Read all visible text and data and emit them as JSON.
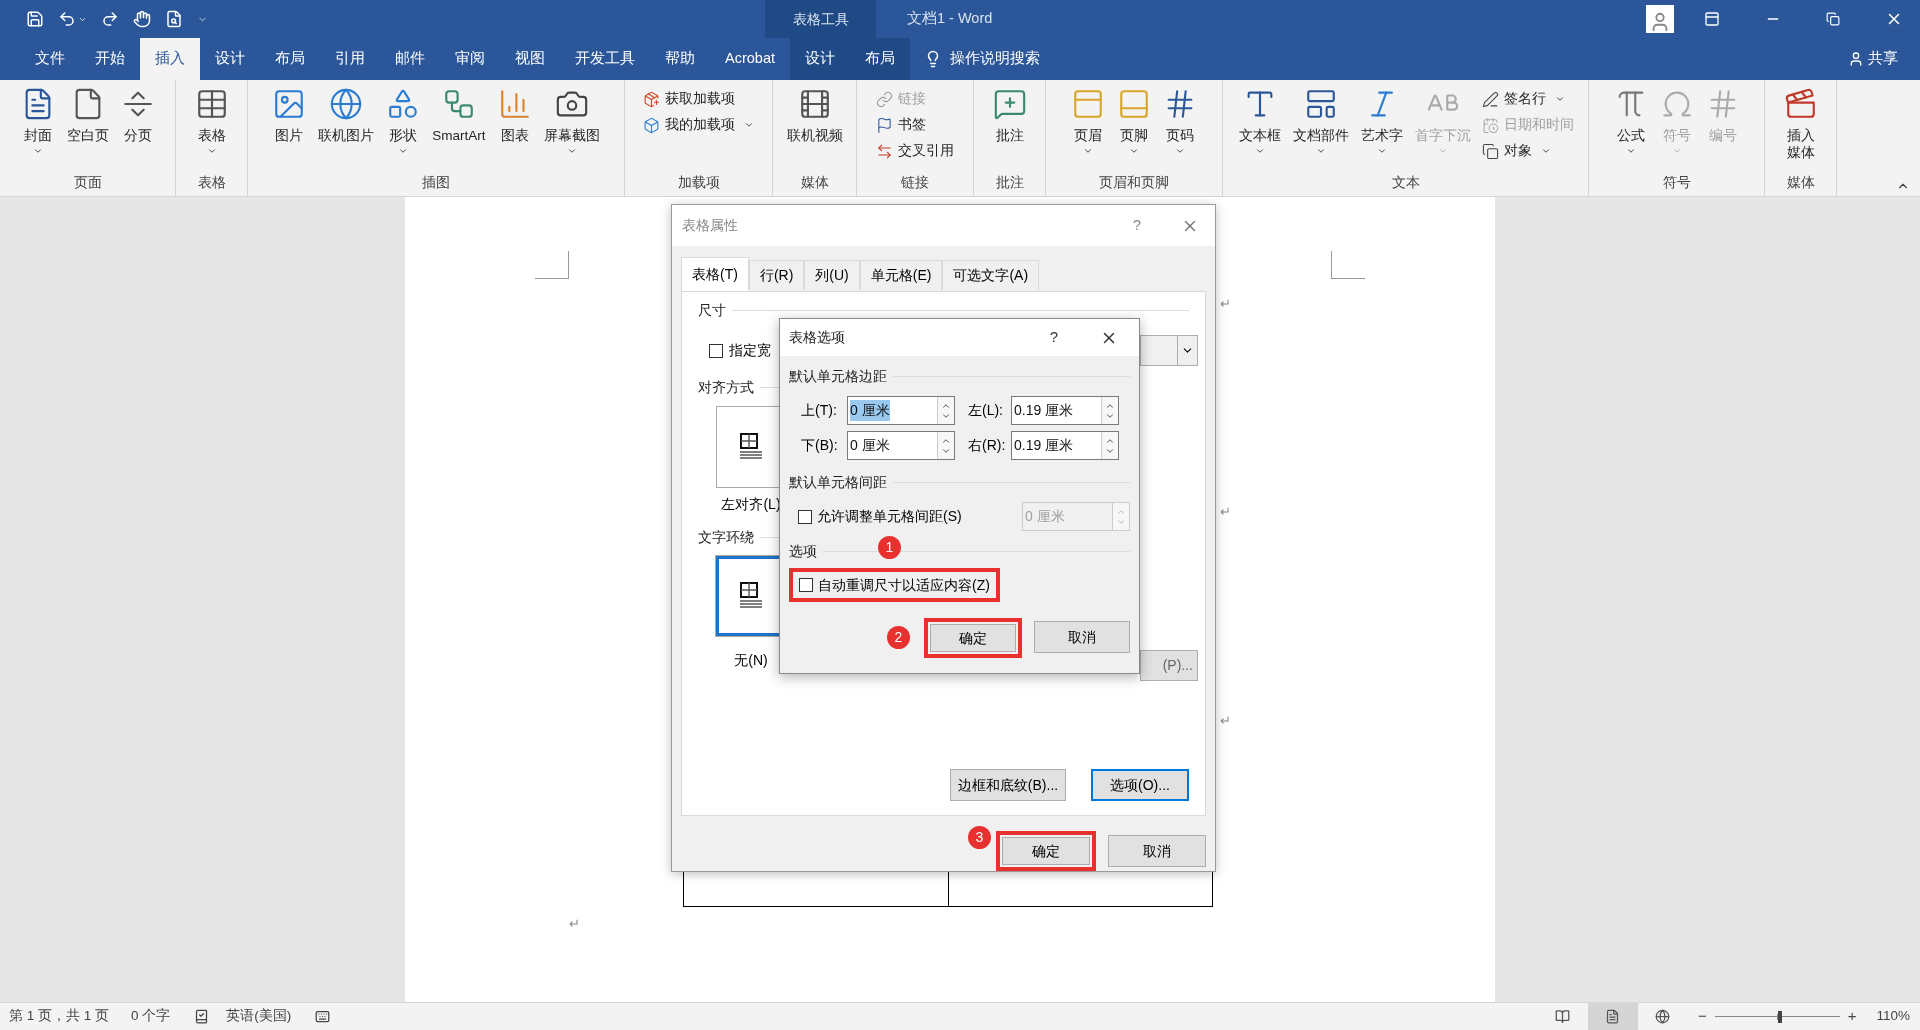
{
  "title_bar": {
    "context_label": "表格工具",
    "title": "文档1 - Word"
  },
  "menu_tabs": [
    {
      "label": "文件",
      "selected": false,
      "contextual": false
    },
    {
      "label": "开始",
      "selected": false,
      "contextual": false
    },
    {
      "label": "插入",
      "selected": true,
      "contextual": false
    },
    {
      "label": "设计",
      "selected": false,
      "contextual": false
    },
    {
      "label": "布局",
      "selected": false,
      "contextual": false
    },
    {
      "label": "引用",
      "selected": false,
      "contextual": false
    },
    {
      "label": "邮件",
      "selected": false,
      "contextual": false
    },
    {
      "label": "审阅",
      "selected": false,
      "contextual": false
    },
    {
      "label": "视图",
      "selected": false,
      "contextual": false
    },
    {
      "label": "开发工具",
      "selected": false,
      "contextual": false
    },
    {
      "label": "帮助",
      "selected": false,
      "contextual": false
    },
    {
      "label": "Acrobat",
      "selected": false,
      "contextual": false
    },
    {
      "label": "设计",
      "selected": false,
      "contextual": true
    },
    {
      "label": "布局",
      "selected": false,
      "contextual": true
    }
  ],
  "tell_me": "操作说明搜索",
  "share": "共享",
  "ribbon": {
    "groups": [
      {
        "label": "页面",
        "items": [
          {
            "label": "封面",
            "kind": "large",
            "dropdown": true,
            "disabled": false
          },
          {
            "label": "空白页",
            "kind": "large",
            "dropdown": false,
            "disabled": false
          },
          {
            "label": "分页",
            "kind": "large",
            "dropdown": false,
            "disabled": false
          }
        ]
      },
      {
        "label": "表格",
        "items": [
          {
            "label": "表格",
            "kind": "large",
            "dropdown": true,
            "disabled": false
          }
        ]
      },
      {
        "label": "插图",
        "items": [
          {
            "label": "图片",
            "kind": "large",
            "dropdown": false,
            "disabled": false
          },
          {
            "label": "联机图片",
            "kind": "large",
            "dropdown": false,
            "disabled": false
          },
          {
            "label": "形状",
            "kind": "large",
            "dropdown": true,
            "disabled": false
          },
          {
            "label": "SmartArt",
            "kind": "large",
            "dropdown": false,
            "disabled": false
          },
          {
            "label": "图表",
            "kind": "large",
            "dropdown": false,
            "disabled": false
          },
          {
            "label": "屏幕截图",
            "kind": "large",
            "dropdown": true,
            "disabled": false
          }
        ]
      },
      {
        "label": "加载项",
        "items": [
          {
            "label": "获取加载项",
            "kind": "small",
            "dropdown": false,
            "disabled": false
          },
          {
            "label": "我的加载项",
            "kind": "small",
            "dropdown": true,
            "disabled": false
          }
        ]
      },
      {
        "label": "媒体",
        "items": [
          {
            "label": "联机视频",
            "kind": "large",
            "dropdown": false,
            "disabled": false
          }
        ]
      },
      {
        "label": "链接",
        "items": [
          {
            "label": "链接",
            "kind": "small",
            "dropdown": false,
            "disabled": true
          },
          {
            "label": "书签",
            "kind": "small",
            "dropdown": false,
            "disabled": false
          },
          {
            "label": "交叉引用",
            "kind": "small",
            "dropdown": false,
            "disabled": false
          }
        ]
      },
      {
        "label": "批注",
        "items": [
          {
            "label": "批注",
            "kind": "large",
            "dropdown": false,
            "disabled": false
          }
        ]
      },
      {
        "label": "页眉和页脚",
        "items": [
          {
            "label": "页眉",
            "kind": "large",
            "dropdown": true,
            "disabled": false
          },
          {
            "label": "页脚",
            "kind": "large",
            "dropdown": true,
            "disabled": false
          },
          {
            "label": "页码",
            "kind": "large",
            "dropdown": true,
            "disabled": false
          }
        ]
      },
      {
        "label": "文本",
        "items": [
          {
            "label": "文本框",
            "kind": "large",
            "dropdown": true,
            "disabled": false
          },
          {
            "label": "文档部件",
            "kind": "large",
            "dropdown": true,
            "disabled": false
          },
          {
            "label": "艺术字",
            "kind": "large",
            "dropdown": true,
            "disabled": false
          },
          {
            "label": "首字下沉",
            "kind": "large",
            "dropdown": true,
            "disabled": true
          },
          {
            "label": "签名行",
            "kind": "small",
            "dropdown": true,
            "disabled": false
          },
          {
            "label": "日期和时间",
            "kind": "small",
            "dropdown": false,
            "disabled": true
          },
          {
            "label": "对象",
            "kind": "small",
            "dropdown": true,
            "disabled": false
          }
        ]
      },
      {
        "label": "符号",
        "items": [
          {
            "label": "公式",
            "kind": "large",
            "dropdown": true,
            "disabled": false
          },
          {
            "label": "符号",
            "kind": "large",
            "dropdown": true,
            "disabled": true
          },
          {
            "label": "编号",
            "kind": "large",
            "dropdown": false,
            "disabled": true
          }
        ]
      },
      {
        "label": "媒体",
        "items": [
          {
            "label": "插入媒体",
            "kind": "large",
            "dropdown": false,
            "disabled": false
          }
        ]
      }
    ]
  },
  "document": {
    "paragraph_marks": [
      "↵",
      "↵",
      "↵",
      "↵"
    ]
  },
  "table_properties": {
    "title": "表格属性",
    "help": "?",
    "tabs": [
      {
        "label": "表格(T)",
        "selected": true
      },
      {
        "label": "行(R)",
        "selected": false
      },
      {
        "label": "列(U)",
        "selected": false
      },
      {
        "label": "单元格(E)",
        "selected": false
      },
      {
        "label": "可选文字(A)",
        "selected": false
      }
    ],
    "size_heading": "尺寸",
    "width_checkbox": {
      "label": "指定宽",
      "checked": false
    },
    "alignment_heading": "对齐方式",
    "alignment_option": {
      "label": "左对齐(L)",
      "selected": false
    },
    "wrapping_heading": "文字环绕",
    "wrapping_option": {
      "label": "无(N)",
      "selected": true
    },
    "positioning_button": "(P)...",
    "borders_button": "边框和底纹(B)...",
    "options_button": "选项(O)...",
    "ok": "确定",
    "ok_badge": "3",
    "cancel": "取消"
  },
  "table_options": {
    "title": "表格选项",
    "help": "?",
    "margins_heading": "默认单元格边距",
    "margins": [
      {
        "label": "上(T):",
        "value": "0 厘米",
        "text_selected": true
      },
      {
        "label": "左(L):",
        "value": "0.19 厘米",
        "text_selected": false
      },
      {
        "label": "下(B):",
        "value": "0 厘米",
        "text_selected": false
      },
      {
        "label": "右(R):",
        "value": "0.19 厘米",
        "text_selected": false
      }
    ],
    "spacing_heading": "默认单元格间距",
    "spacing": {
      "label": "允许调整单元格间距(S)",
      "checked": false,
      "value": "0 厘米",
      "disabled": true
    },
    "options_heading": "选项",
    "autofit": {
      "label": "自动重调尺寸以适应内容(Z)",
      "checked": false,
      "badge": "1"
    },
    "ok": "确定",
    "ok_badge": "2",
    "cancel": "取消"
  },
  "status_bar": {
    "page": "第 1 页，共 1 页",
    "words": "0 个字",
    "language": "英语(美国)",
    "views": [
      {
        "selected": false
      },
      {
        "selected": true
      },
      {
        "selected": false
      }
    ],
    "zoom_out": "−",
    "zoom_in": "+",
    "zoom": {
      "level": 0.52
    },
    "zoom_percent": "110%"
  }
}
